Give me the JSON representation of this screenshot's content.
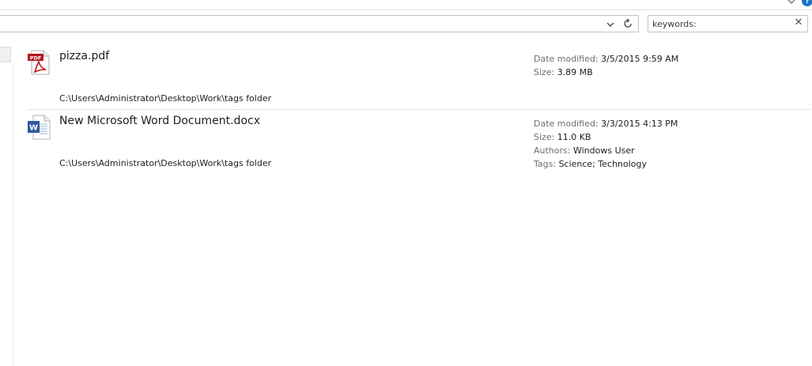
{
  "search": {
    "value": "keywords:",
    "clear_icon": "close-icon"
  },
  "address_bar": {
    "dropdown_icon": "chevron-down-icon",
    "refresh_icon": "refresh-icon"
  },
  "help_icon": "help-icon",
  "results": [
    {
      "name": "pizza.pdf",
      "icon": "pdf-file-icon",
      "path": "C:\\Users\\Administrator\\Desktop\\Work\\tags folder",
      "meta": [
        {
          "label": "Date modified:",
          "value": "3/5/2015 9:59 AM"
        },
        {
          "label": "Size:",
          "value": "3.89 MB"
        }
      ]
    },
    {
      "name": "New Microsoft Word Document.docx",
      "icon": "word-file-icon",
      "path": "C:\\Users\\Administrator\\Desktop\\Work\\tags folder",
      "meta": [
        {
          "label": "Date modified:",
          "value": "3/3/2015 4:13 PM"
        },
        {
          "label": "Size:",
          "value": "11.0 KB"
        },
        {
          "label": "Authors:",
          "value": "Windows User"
        },
        {
          "label": "Tags:",
          "value": "Science; Technology"
        }
      ]
    }
  ]
}
